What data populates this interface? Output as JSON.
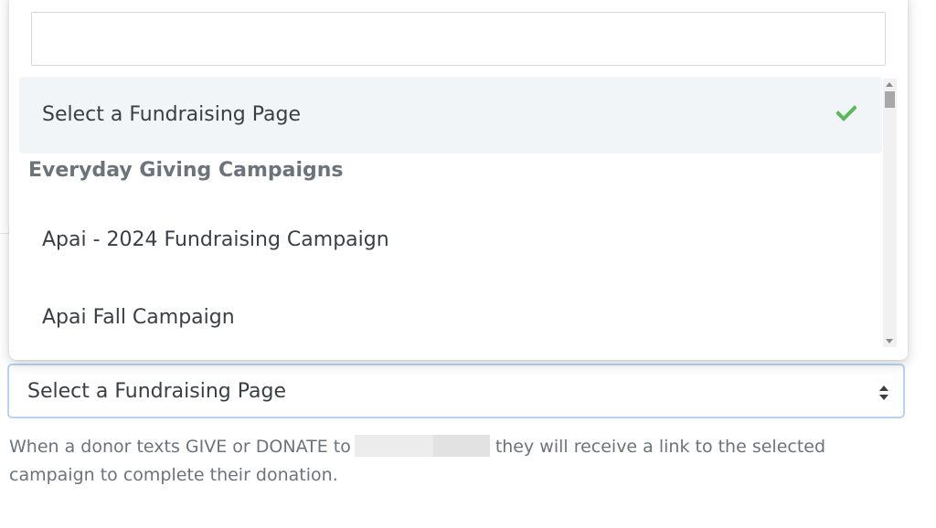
{
  "dropdown": {
    "search": {
      "value": "",
      "placeholder": ""
    },
    "options": [
      {
        "label": "Select a Fundraising Page",
        "selected": true
      },
      {
        "group_label": "Everyday Giving Campaigns"
      },
      {
        "label": "Apai - 2024 Fundraising Campaign",
        "selected": false
      },
      {
        "label": "Apai Fall Campaign",
        "selected": false
      }
    ],
    "check_color": "#5cb85c",
    "check_icon": "check-icon"
  },
  "select": {
    "value": "Select a Fundraising Page",
    "arrows_icon": "sort-arrows-icon"
  },
  "help": {
    "before": "When a donor texts GIVE or DONATE to",
    "after": "they will receive a link to the selected campaign to complete their donation."
  },
  "colors": {
    "focus_border": "#b9d4f2",
    "selected_bg": "#f2f5f8",
    "muted_text": "#6c737a"
  }
}
